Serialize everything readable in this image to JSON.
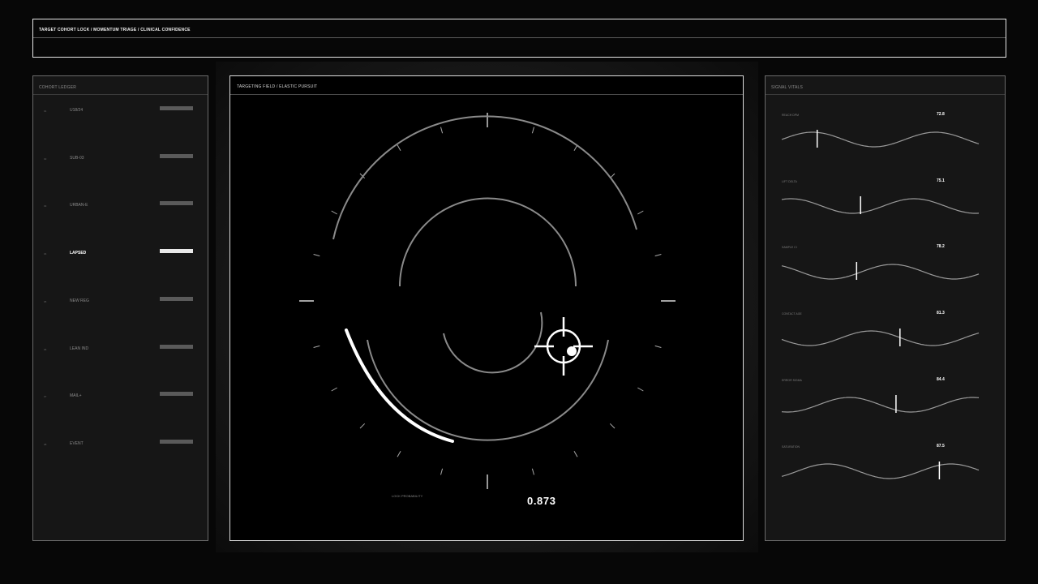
{
  "header": {
    "title": "TARGET COHORT LOCK / MOMENTUM TRIAGE / CLINICAL CONFIDENCE"
  },
  "ledger": {
    "title": "COHORT LEDGER",
    "items": [
      {
        "index": "01",
        "label": "U18/24",
        "active": false
      },
      {
        "index": "02",
        "label": "SUB-03",
        "active": false
      },
      {
        "index": "03",
        "label": "URBAN-E",
        "active": false
      },
      {
        "index": "04",
        "label": "LAPSED",
        "active": true
      },
      {
        "index": "05",
        "label": "NEW REG",
        "active": false
      },
      {
        "index": "06",
        "label": "LEAN IND",
        "active": false
      },
      {
        "index": "07",
        "label": "MAIL+",
        "active": false
      },
      {
        "index": "08",
        "label": "EVENT",
        "active": false
      }
    ]
  },
  "targeting": {
    "title": "TARGETING FIELD / ELASTIC PURSUIT",
    "lock_label": "LOCK PROBABILITY",
    "lock_value": "0.873",
    "lock_probability": 0.873,
    "crosshair_icon": "crosshair-icon"
  },
  "vitals": {
    "title": "SIGNAL VITALS",
    "items": [
      {
        "label": "REACH DPM",
        "value": "72.8",
        "marker": 0.18
      },
      {
        "label": "LIFT DELTA",
        "value": "75.1",
        "marker": 0.4
      },
      {
        "label": "SAMPLE CI",
        "value": "78.2",
        "marker": 0.38
      },
      {
        "label": "CONTACT AGE",
        "value": "81.3",
        "marker": 0.6
      },
      {
        "label": "ERROR SIGMA",
        "value": "84.4",
        "marker": 0.58
      },
      {
        "label": "SATURATION",
        "value": "87.5",
        "marker": 0.8
      }
    ]
  },
  "colors": {
    "accent": "#ffffff",
    "muted": "#5a5a5a",
    "background": "#070707"
  }
}
